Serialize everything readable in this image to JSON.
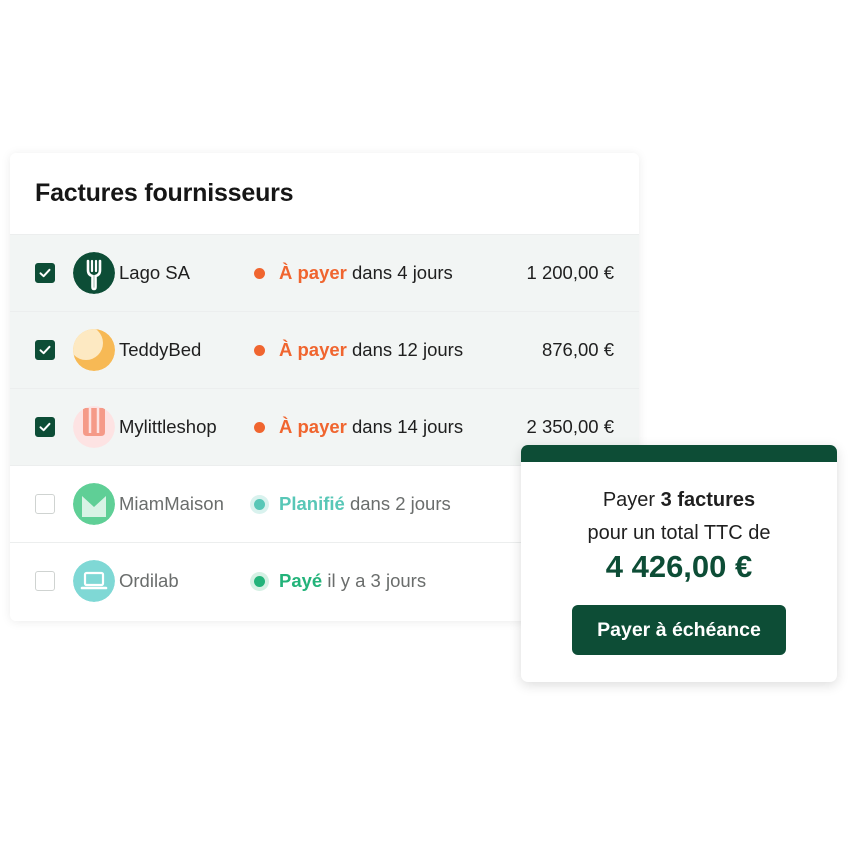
{
  "card": {
    "title": "Factures fournisseurs"
  },
  "colors": {
    "brand": "#0d4d36",
    "due": "#f0652f",
    "planned": "#58c7b7",
    "paid": "#23b37a"
  },
  "invoices": [
    {
      "checked": true,
      "avatar_icon": "fork-icon",
      "supplier": "Lago SA",
      "status_label": "À payer",
      "status_suffix": " dans 4 jours",
      "status_color": "#f0652f",
      "amount": "1 200,00 €"
    },
    {
      "checked": true,
      "avatar_icon": "moon-icon",
      "supplier": "TeddyBed",
      "status_label": "À payer",
      "status_suffix": " dans 12 jours",
      "status_color": "#f0652f",
      "amount": "876,00 €"
    },
    {
      "checked": true,
      "avatar_icon": "shop-icon",
      "supplier": "Mylittleshop",
      "status_label": "À payer",
      "status_suffix": " dans 14 jours",
      "status_color": "#f0652f",
      "amount": "2 350,00 €"
    },
    {
      "checked": false,
      "avatar_icon": "m-letter-icon",
      "supplier": "MiamMaison",
      "status_label": "Planifié",
      "status_suffix": " dans 2 jours",
      "status_color": "#58c7b7",
      "amount": ""
    },
    {
      "checked": false,
      "avatar_icon": "laptop-icon",
      "supplier": "Ordilab",
      "status_label": "Payé",
      "status_suffix": " il y a 3 jours",
      "status_color": "#23b37a",
      "amount": ""
    }
  ],
  "payment": {
    "line1_prefix": "Payer ",
    "line1_bold": "3 factures",
    "line2": "pour un total TTC de",
    "total": "4 426,00 €",
    "button_label": "Payer à échéance"
  }
}
